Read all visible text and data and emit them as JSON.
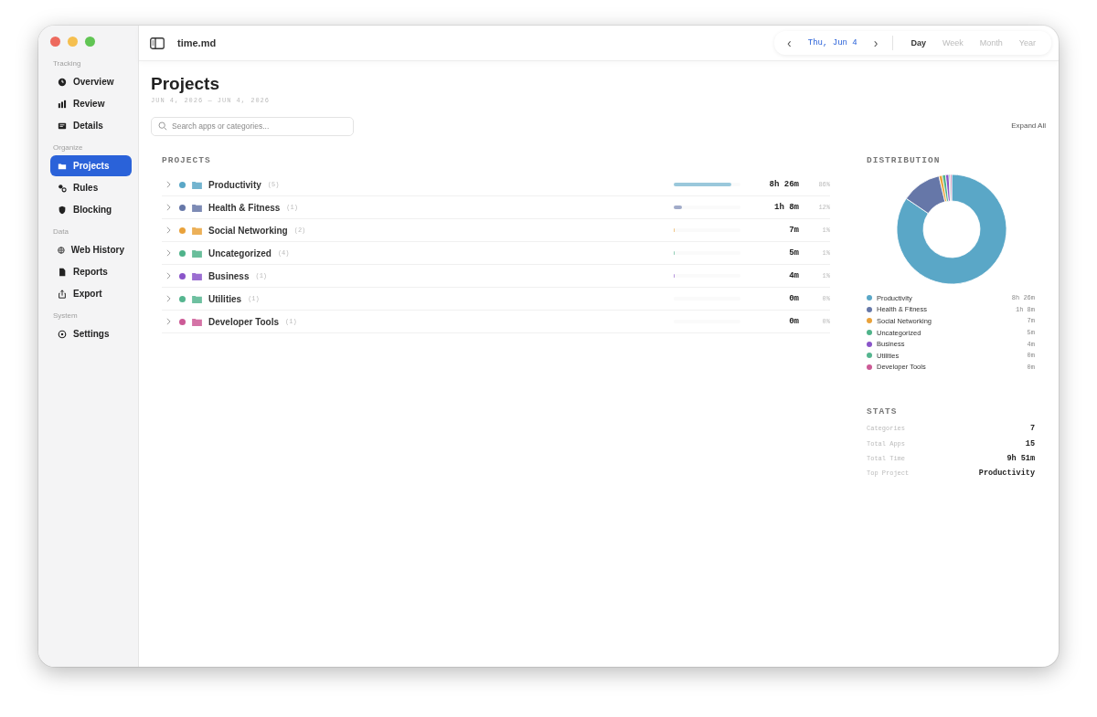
{
  "window": {
    "title": "time.md"
  },
  "sidebar": {
    "sections": [
      {
        "heading": "Tracking",
        "items": [
          {
            "label": "Overview",
            "selected": false
          },
          {
            "label": "Review",
            "selected": false
          },
          {
            "label": "Details",
            "selected": false
          }
        ]
      },
      {
        "heading": "Organize",
        "items": [
          {
            "label": "Projects",
            "selected": true
          },
          {
            "label": "Rules",
            "selected": false
          },
          {
            "label": "Blocking",
            "selected": false
          }
        ]
      },
      {
        "heading": "Data",
        "items": [
          {
            "label": "Web History",
            "selected": false
          },
          {
            "label": "Reports",
            "selected": false
          },
          {
            "label": "Export",
            "selected": false
          }
        ]
      },
      {
        "heading": "System",
        "items": [
          {
            "label": "Settings",
            "selected": false
          }
        ]
      }
    ]
  },
  "date_nav": {
    "prev": "‹",
    "date": "Thu, Jun 4",
    "next": "›",
    "ranges": [
      {
        "label": "Day",
        "selected": true
      },
      {
        "label": "Week",
        "selected": false
      },
      {
        "label": "Month",
        "selected": false
      },
      {
        "label": "Year",
        "selected": false
      }
    ]
  },
  "page": {
    "title": "Projects",
    "date_range": "JUN 4, 2026 — JUN 4, 2026",
    "search": {
      "placeholder": "Search apps or categories..."
    },
    "expand_all": "Expand All"
  },
  "projects": {
    "heading": "PROJECTS",
    "rows": [
      {
        "name": "Productivity",
        "count": "(5)",
        "color": "#5aa7c7",
        "level": 0.86,
        "time": "8h 26m",
        "percent": "86%"
      },
      {
        "name": "Health & Fitness",
        "count": "(1)",
        "color": "#6677a8",
        "level": 0.12,
        "time": "1h 8m",
        "percent": "12%"
      },
      {
        "name": "Social Networking",
        "count": "(2)",
        "color": "#e9a23b",
        "level": 0.01,
        "time": "7m",
        "percent": "1%"
      },
      {
        "name": "Uncategorized",
        "count": "(4)",
        "color": "#4fb38a",
        "level": 0.01,
        "time": "5m",
        "percent": "1%"
      },
      {
        "name": "Business",
        "count": "(1)",
        "color": "#8a55c9",
        "level": 0.01,
        "time": "4m",
        "percent": "1%"
      },
      {
        "name": "Utilities",
        "count": "(1)",
        "color": "#55b58f",
        "level": 0,
        "time": "0m",
        "percent": "0%"
      },
      {
        "name": "Developer Tools",
        "count": "(1)",
        "color": "#cc5a96",
        "level": 0,
        "time": "0m",
        "percent": "0%"
      }
    ]
  },
  "distribution": {
    "heading": "DISTRIBUTION",
    "legend": [
      {
        "name": "Productivity",
        "time": "8h 26m"
      },
      {
        "name": "Health & Fitness",
        "time": "1h 8m"
      },
      {
        "name": "Social Networking",
        "time": "7m"
      },
      {
        "name": "Uncategorized",
        "time": "5m"
      },
      {
        "name": "Business",
        "time": "4m"
      },
      {
        "name": "Utilities",
        "time": "0m"
      },
      {
        "name": "Developer Tools",
        "time": "0m"
      }
    ]
  },
  "stats": {
    "heading": "STATS",
    "rows": [
      {
        "label": "Categories",
        "value": "7"
      },
      {
        "label": "Total Apps",
        "value": "15"
      },
      {
        "label": "Total Time",
        "value": "9h 51m"
      },
      {
        "label": "Top Project",
        "value": "Productivity"
      }
    ]
  }
}
